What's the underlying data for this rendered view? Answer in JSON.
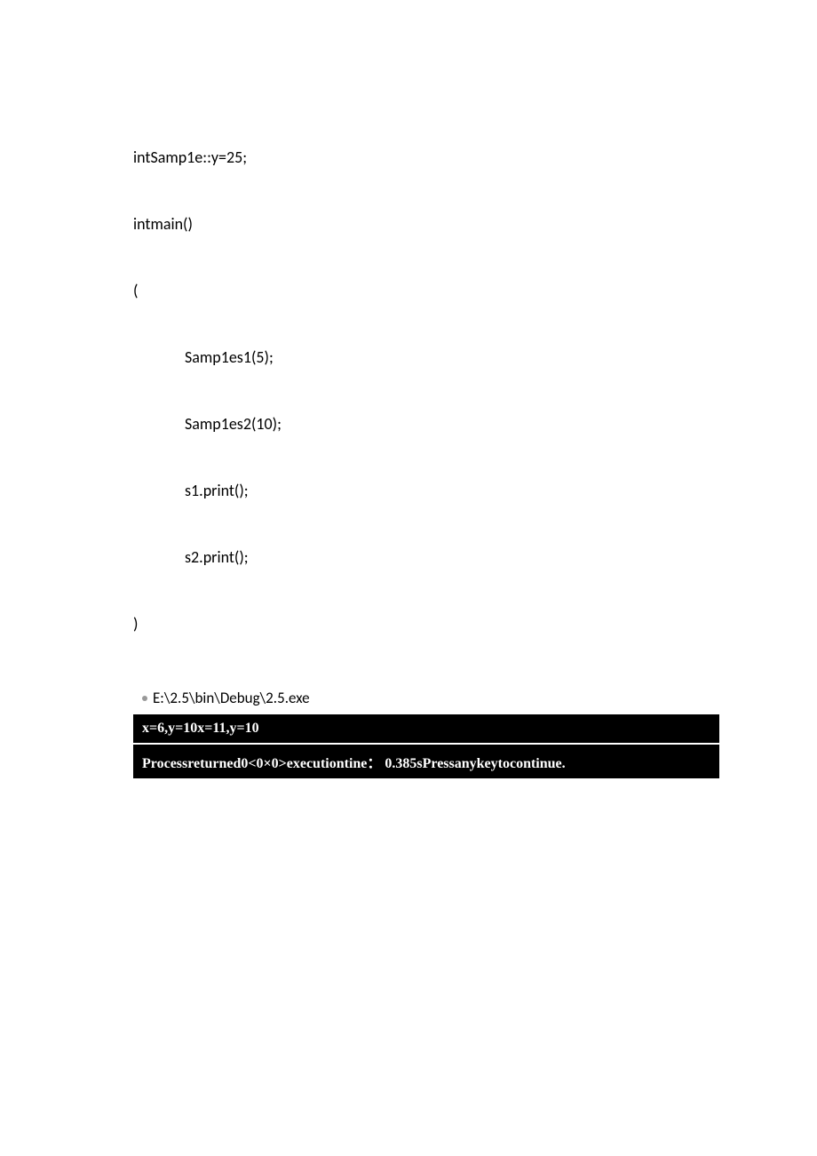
{
  "code": {
    "l1": "intSamp1e::y=25;",
    "l2": "intmain()",
    "l3": "(",
    "l4": "Samp1es1(5);",
    "l5": "Samp1es2(10);",
    "l6": "s1.print();",
    "l7": "s2.print();",
    "l8": ")"
  },
  "titlebar": {
    "path": "E:\\2.5\\bin\\Debug\\2.5.exe"
  },
  "console": {
    "line1": "x=6,y=10x=11,y=10",
    "line2": "Processreturned0<0×0>executiontine： 0.385sPressanykeytocontinue."
  }
}
